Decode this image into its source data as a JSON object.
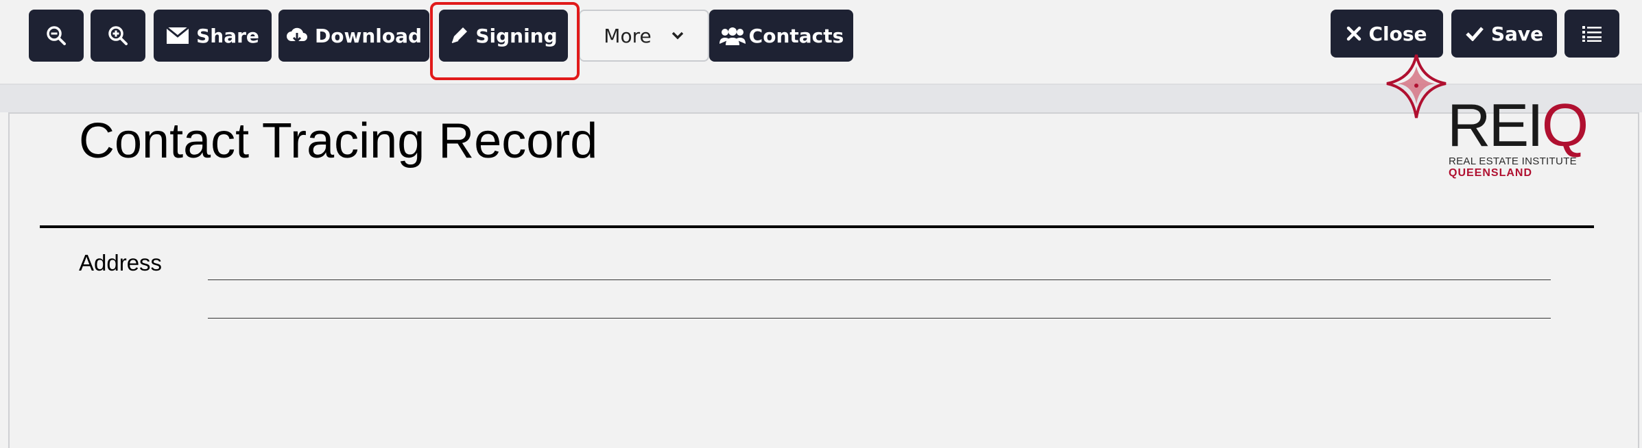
{
  "toolbar": {
    "zoom_out_label": "",
    "zoom_in_label": "",
    "share_label": "Share",
    "download_label": "Download",
    "signing_label": "Signing",
    "more_label": "More",
    "contacts_label": "Contacts",
    "close_label": "Close",
    "save_label": "Save",
    "icons": {
      "zoom_out": "zoom-out-icon",
      "zoom_in": "zoom-in-icon",
      "share": "envelope-icon",
      "download": "cloud-download-icon",
      "signing": "pen-icon",
      "more": "chevron-down-icon",
      "contacts": "users-icon",
      "close": "x-icon",
      "save": "check-icon",
      "menu": "list-icon"
    },
    "colors": {
      "button_bg": "#1e2233",
      "highlight": "#e11a1a"
    }
  },
  "document": {
    "title": "Contact Tracing Record",
    "address_label": "Address",
    "logo": {
      "wordmark": "REIQ",
      "subtitle_line1": "REAL ESTATE INSTITUTE",
      "subtitle_line2": "QUEENSLAND",
      "brand_color": "#b01030"
    }
  }
}
